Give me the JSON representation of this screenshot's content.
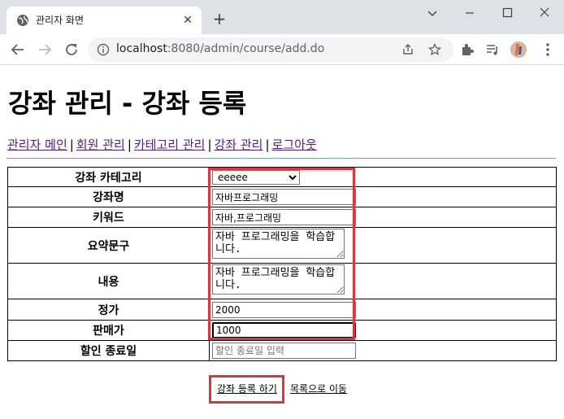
{
  "browser": {
    "tab_title": "관리자 화면",
    "tab_close": "✕",
    "new_tab": "+",
    "url_host": "localhost",
    "url_rest": ":8080/admin/course/add.do"
  },
  "page": {
    "title": "강좌 관리 - 강좌 등록",
    "nav": [
      "관리자 메인",
      "회원 관리",
      "카테고리 관리",
      "강좌 관리",
      "로그아웃"
    ],
    "nav_separator": "|"
  },
  "form": {
    "labels": {
      "category": "강좌 카테고리",
      "subject": "강좌명",
      "keyword": "키워드",
      "summary": "요약문구",
      "contents": "내용",
      "price": "정가",
      "sale_price": "판매가",
      "sale_end": "할인 종료일"
    },
    "category_selected": "eeeee",
    "subject_value": "자바프로그래밍",
    "keyword_value": "자바,프로그래밍",
    "summary_value": "자바 프로그래밍을 학습합니다.",
    "contents_value": "자바 프로그래밍을 학습합니다.",
    "price_value": "2000",
    "sale_price_value": "1000",
    "sale_end_placeholder": "할인 종료일 입력"
  },
  "actions": {
    "submit_label": "강좌 등록 하기",
    "list_label": "목록으로 이동"
  },
  "colors": {
    "highlight": "#e53236",
    "visited_link": "#551a8b"
  }
}
